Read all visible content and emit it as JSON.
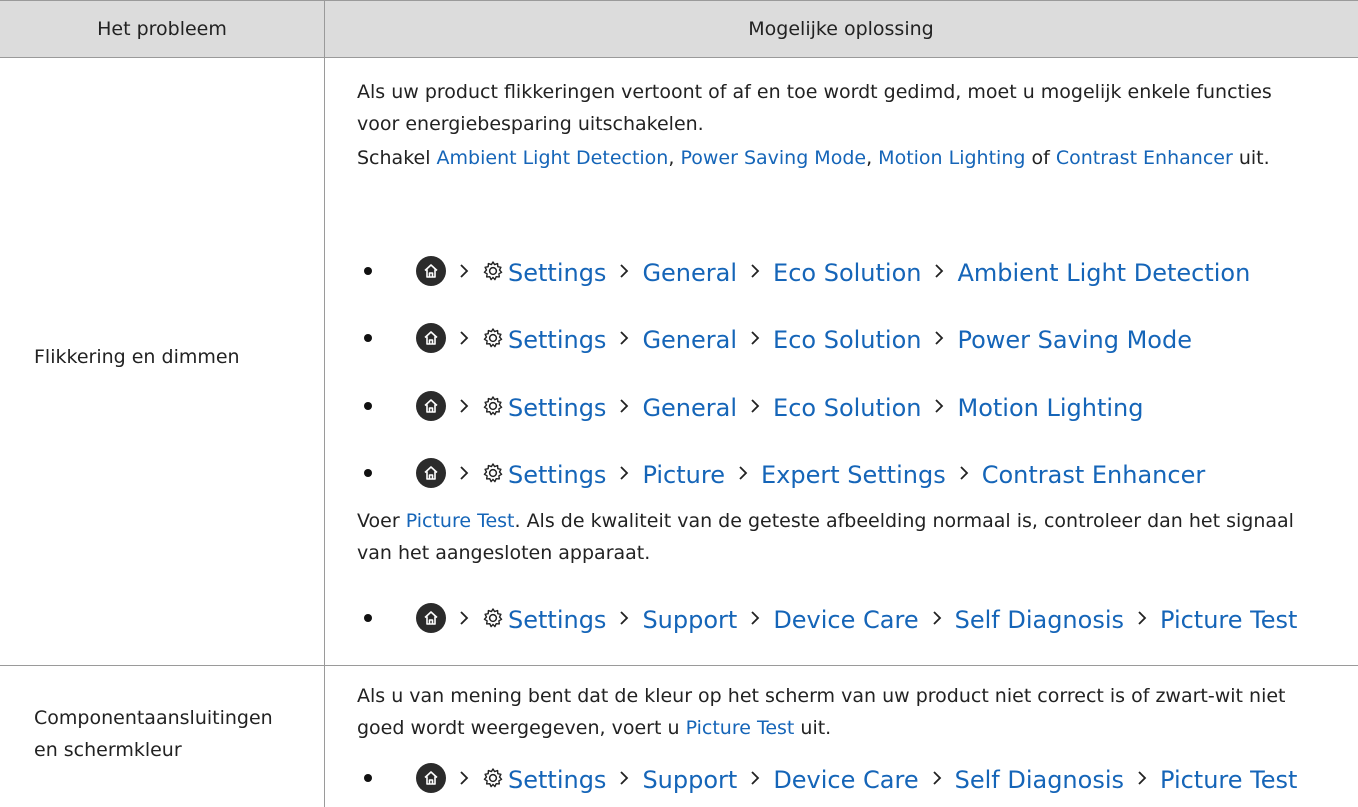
{
  "header": {
    "col1": "Het probleem",
    "col2": "Mogelijke oplossing"
  },
  "colors": {
    "link": "#1565b8",
    "header_bg": "#dcdcdc",
    "border": "#9a9a9a"
  },
  "row1": {
    "label": "Flikkering en dimmen",
    "para1": "Als uw product flikkeringen vertoont of af en toe wordt gedimd, moet u mogelijk enkele functies voor energiebesparing uitschakelen.",
    "para2": {
      "t1": "Schakel ",
      "l1": "Ambient Light Detection",
      "t2": ", ",
      "l2": "Power Saving Mode",
      "t3": ", ",
      "l3": "Motion Lighting",
      "t4": " of ",
      "l4": "Contrast Enhancer",
      "t5": " uit."
    },
    "paths": [
      {
        "s1": "Settings",
        "s2": "General",
        "s3": "Eco Solution",
        "s4": "Ambient Light Detection"
      },
      {
        "s1": "Settings",
        "s2": "General",
        "s3": "Eco Solution",
        "s4": "Power Saving Mode"
      },
      {
        "s1": "Settings",
        "s2": "General",
        "s3": "Eco Solution",
        "s4": "Motion Lighting"
      },
      {
        "s1": "Settings",
        "s2": "Picture",
        "s3": "Expert Settings",
        "s4": "Contrast Enhancer"
      }
    ],
    "para3": {
      "t1": "Voer ",
      "l1": "Picture Test",
      "t2": ". Als de kwaliteit van de geteste afbeelding normaal is, controleer dan het signaal van het aangesloten apparaat."
    },
    "path5": {
      "s1": "Settings",
      "s2": "Support",
      "s3": "Device Care",
      "s4": "Self Diagnosis",
      "s5": "Picture Test"
    }
  },
  "row2": {
    "label_line1": "Componentaansluitingen",
    "label_line2": "en schermkleur",
    "para1": {
      "t1": "Als u van mening bent dat de kleur op het scherm van uw product niet correct is of zwart-wit niet goed wordt weergegeven, voert u ",
      "l1": "Picture Test",
      "t2": " uit."
    },
    "path": {
      "s1": "Settings",
      "s2": "Support",
      "s3": "Device Care",
      "s4": "Self Diagnosis",
      "s5": "Picture Test"
    }
  }
}
